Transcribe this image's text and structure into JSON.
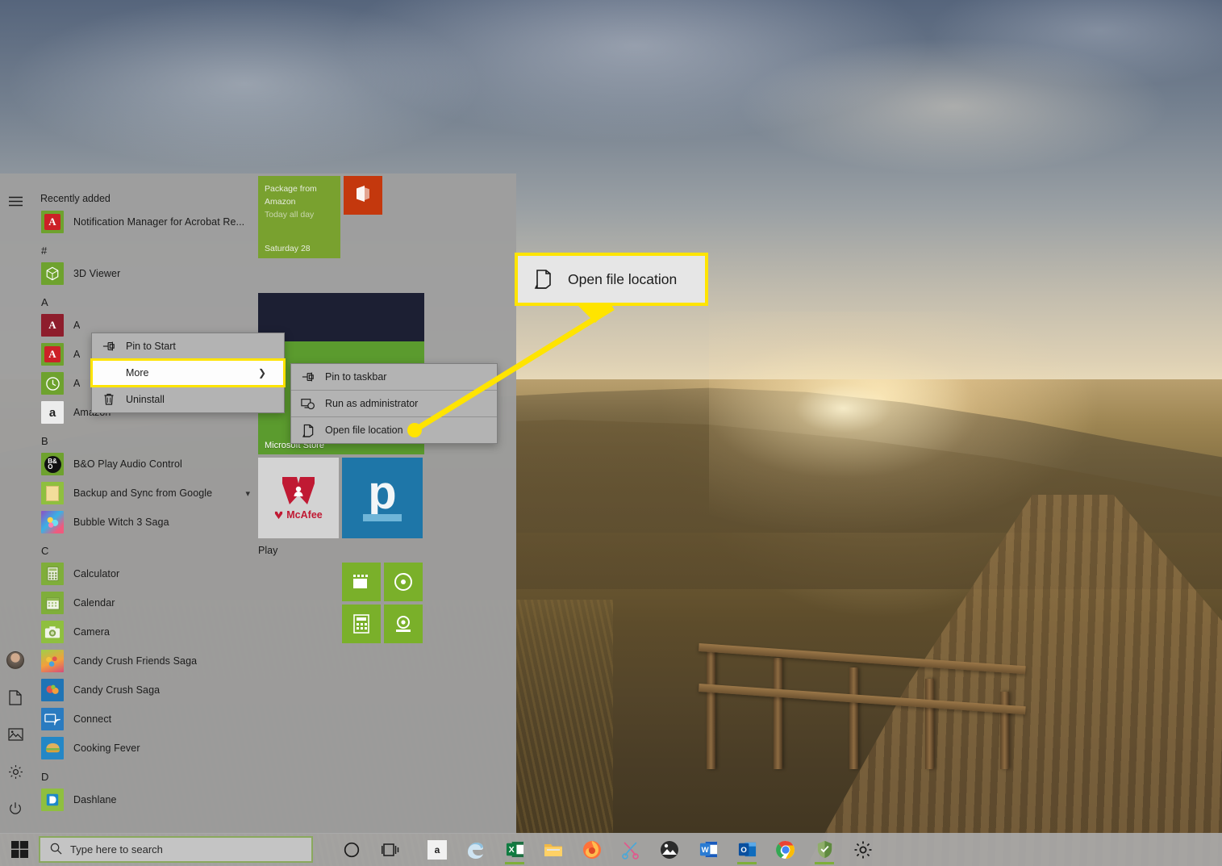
{
  "desktop": {
    "name": "windows-10-desktop"
  },
  "start_menu": {
    "left_rail": [
      {
        "name": "user-avatar",
        "label": "User account"
      },
      {
        "name": "documents-icon",
        "label": "Documents"
      },
      {
        "name": "pictures-icon",
        "label": "Pictures"
      },
      {
        "name": "settings-gear-icon",
        "label": "Settings"
      },
      {
        "name": "power-icon",
        "label": "Power"
      }
    ],
    "hamburger_label": "Expand menu",
    "recently_added_header": "Recently added",
    "app_list": [
      {
        "type": "app",
        "label": "Notification Manager for Acrobat Re...",
        "icon": "acrobat",
        "chevron": false
      },
      {
        "type": "head",
        "label": "#"
      },
      {
        "type": "app",
        "label": "3D Viewer",
        "icon": "3dviewer",
        "chevron": false
      },
      {
        "type": "head",
        "label": "A"
      },
      {
        "type": "app",
        "label": "A",
        "icon": "autodesk",
        "chevron": false
      },
      {
        "type": "app",
        "label": "A",
        "icon": "acrobat",
        "chevron": false
      },
      {
        "type": "app",
        "label": "A",
        "icon": "alarms",
        "chevron": false
      },
      {
        "type": "app",
        "label": "Amazon",
        "icon": "amazon",
        "chevron": false
      },
      {
        "type": "head",
        "label": "B"
      },
      {
        "type": "app",
        "label": "B&O Play Audio Control",
        "icon": "bando",
        "chevron": false
      },
      {
        "type": "app",
        "label": "Backup and Sync from Google",
        "icon": "backup",
        "chevron": true
      },
      {
        "type": "app",
        "label": "Bubble Witch 3 Saga",
        "icon": "bubble",
        "chevron": false
      },
      {
        "type": "head",
        "label": "C"
      },
      {
        "type": "app",
        "label": "Calculator",
        "icon": "calculator",
        "chevron": false
      },
      {
        "type": "app",
        "label": "Calendar",
        "icon": "calendar",
        "chevron": false
      },
      {
        "type": "app",
        "label": "Camera",
        "icon": "camera",
        "chevron": false
      },
      {
        "type": "app",
        "label": "Candy Crush Friends Saga",
        "icon": "candyfriends",
        "chevron": false
      },
      {
        "type": "app",
        "label": "Candy Crush Saga",
        "icon": "candy",
        "chevron": false
      },
      {
        "type": "app",
        "label": "Connect",
        "icon": "connect",
        "chevron": false
      },
      {
        "type": "app",
        "label": "Cooking Fever",
        "icon": "cooking",
        "chevron": false
      },
      {
        "type": "head",
        "label": "D"
      },
      {
        "type": "app",
        "label": "Dashlane",
        "icon": "dashlane",
        "chevron": false
      }
    ],
    "tiles": {
      "calendar_tile": {
        "line1": "Package from",
        "line2": "Amazon",
        "line3": "Today all day",
        "date": "Saturday 28",
        "color": "#79a12f"
      },
      "office_tile": {
        "label": "",
        "color": "#c4380d",
        "glyph": "office-icon"
      },
      "dark_tile": {
        "label": "",
        "color": "#1c1f33"
      },
      "store_tile": {
        "label": "Microsoft Store",
        "color": "#5b9b2e"
      },
      "mcafee_tile": {
        "label": "McAfee",
        "color": "#d3d3d3",
        "accent": "#c01933"
      },
      "pandora_tile": {
        "label": "p",
        "color": "#1e76a8"
      },
      "play_group_label": "Play",
      "play_tiles": [
        {
          "name": "movies-tile",
          "color": "#7ab02a",
          "glyph": "film-icon"
        },
        {
          "name": "groove-tile",
          "color": "#7ab02a",
          "glyph": "music-icon"
        },
        {
          "name": "calculator-tile",
          "color": "#7ab02a",
          "glyph": "calculator-icon"
        },
        {
          "name": "camera-tile",
          "color": "#7ab02a",
          "glyph": "camera-icon"
        }
      ]
    }
  },
  "context_menu_primary": {
    "items": [
      {
        "label": "Pin to Start",
        "icon": "pin-icon",
        "submenu": false,
        "highlighted": false
      },
      {
        "label": "More",
        "icon": "",
        "submenu": true,
        "highlighted": true
      },
      {
        "label": "Uninstall",
        "icon": "trash-icon",
        "submenu": false,
        "highlighted": false
      }
    ]
  },
  "context_menu_submenu": {
    "items": [
      {
        "label": "Pin to taskbar",
        "icon": "pin-icon"
      },
      {
        "label": "Run as administrator",
        "icon": "shield-window-icon"
      },
      {
        "label": "Open file location",
        "icon": "folder-open-icon"
      }
    ]
  },
  "callout": {
    "label": "Open file location",
    "icon": "folder-open-icon",
    "border_color": "#ffe400",
    "background": "#e6e6e6"
  },
  "taskbar": {
    "start_button_label": "Start",
    "search": {
      "placeholder": "Type here to search",
      "icon": "search-icon",
      "highlight_color": "#8aa95e"
    },
    "cortana_label": "Cortana",
    "task_view_label": "Task View",
    "pinned": [
      {
        "name": "amazon-taskbar-icon",
        "label": "Amazon",
        "open": false
      },
      {
        "name": "edge-taskbar-icon",
        "label": "Microsoft Edge",
        "open": false
      },
      {
        "name": "excel-taskbar-icon",
        "label": "Excel",
        "open": true
      },
      {
        "name": "file-explorer-taskbar-icon",
        "label": "File Explorer",
        "open": false
      },
      {
        "name": "firefox-taskbar-icon",
        "label": "Firefox",
        "open": false
      },
      {
        "name": "snip-sketch-taskbar-icon",
        "label": "Snip & Sketch",
        "open": false
      },
      {
        "name": "photos-taskbar-icon",
        "label": "Photos",
        "open": false
      },
      {
        "name": "word-taskbar-icon",
        "label": "Word",
        "open": false
      },
      {
        "name": "outlook-taskbar-icon",
        "label": "Outlook",
        "open": true
      },
      {
        "name": "chrome-taskbar-icon",
        "label": "Google Chrome",
        "open": false
      },
      {
        "name": "security-taskbar-icon",
        "label": "Windows Security",
        "open": true
      },
      {
        "name": "settings-taskbar-icon",
        "label": "Settings",
        "open": false
      }
    ]
  }
}
